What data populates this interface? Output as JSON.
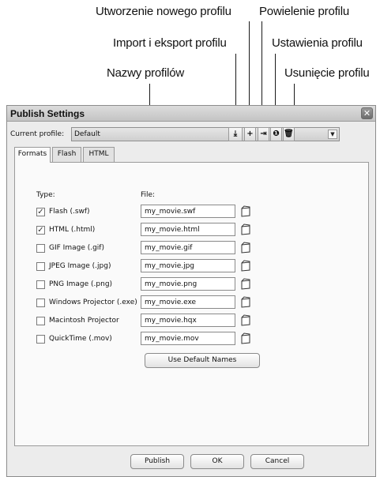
{
  "callouts": {
    "create_profile": "Utworzenie nowego profilu",
    "duplicate_profile": "Powielenie profilu",
    "import_export": "Import i eksport profilu",
    "profile_settings": "Ustawienia profilu",
    "profile_names": "Nazwy profilów",
    "delete_profile": "Usunięcie profilu"
  },
  "dialog": {
    "title": "Publish Settings",
    "close_icon": "close-icon",
    "profile_label": "Current profile:",
    "profile_value": "Default",
    "toolbar": {
      "import_export": "⤓",
      "create": "+",
      "duplicate": "⇥",
      "settings": "❶",
      "delete": "🗑"
    },
    "tabs": [
      "Formats",
      "Flash",
      "HTML"
    ],
    "active_tab": "Formats",
    "type_header": "Type:",
    "file_header": "File:",
    "formats": [
      {
        "label": "Flash  (.swf)",
        "checked": true,
        "file": "my_movie.swf"
      },
      {
        "label": "HTML  (.html)",
        "checked": true,
        "file": "my_movie.html"
      },
      {
        "label": "GIF Image  (.gif)",
        "checked": false,
        "file": "my_movie.gif"
      },
      {
        "label": "JPEG Image  (.jpg)",
        "checked": false,
        "file": "my_movie.jpg"
      },
      {
        "label": "PNG Image  (.png)",
        "checked": false,
        "file": "my_movie.png"
      },
      {
        "label": "Windows Projector  (.exe)",
        "checked": false,
        "file": "my_movie.exe"
      },
      {
        "label": "Macintosh Projector",
        "checked": false,
        "file": "my_movie.hqx"
      },
      {
        "label": "QuickTime  (.mov)",
        "checked": false,
        "file": "my_movie.mov"
      }
    ],
    "use_default_names": "Use Default Names",
    "publish": "Publish",
    "ok": "OK",
    "cancel": "Cancel"
  }
}
